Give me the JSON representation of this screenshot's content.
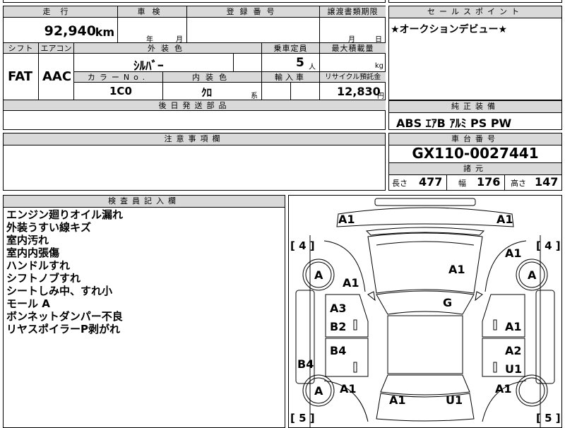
{
  "top_partial": {
    "text": "車 検 月"
  },
  "main": {
    "mileage_label": "走行",
    "mileage_value": "92,940",
    "mileage_unit": "km",
    "inspection_label": "車検",
    "inspection_year_unit": "年",
    "inspection_month_unit": "月",
    "registration_label": "登録番号",
    "transfer_label": "譲渡書類期限",
    "transfer_month_unit": "月",
    "transfer_day_unit": "日",
    "shift_label": "シフト",
    "aircon_label": "エアコン",
    "exterior_color_label": "外装色",
    "capacity_label": "乗車定員",
    "max_load_label": "最大積載量",
    "shift_value": "FAT",
    "aircon_value": "AAC",
    "exterior_color_value": "ｼﾙﾊﾞｰ",
    "capacity_value": "5",
    "capacity_unit": "人",
    "max_load_unit": "kg",
    "color_no_label": "カラーNo.",
    "interior_color_label": "内装色",
    "import_label": "輸入車",
    "recycle_label": "リサイクル預託金",
    "color_no_value": "1C0",
    "interior_color_value": "ｸﾛ",
    "interior_color_suffix": "系",
    "recycle_value": "12,830",
    "recycle_unit": "円",
    "later_parts_label": "後日発送部品"
  },
  "sales_point": {
    "label": "セールスポイント",
    "text": "★オークションデビュー★"
  },
  "equipment": {
    "label": "純正装備",
    "text": "ABS ｴｱB ｱﾙﾐ PS PW"
  },
  "notes": {
    "label": "注意事項欄"
  },
  "chassis": {
    "label": "車台番号",
    "value": "GX110-0027441",
    "spec_label": "諸元",
    "length_label": "長さ",
    "length_value": "477",
    "width_label": "幅",
    "width_value": "176",
    "height_label": "高さ",
    "height_value": "147"
  },
  "inspector": {
    "label": "検査員記入欄",
    "lines": [
      "エンジン廻りオイル漏れ",
      "外装うすい線キズ",
      "室内汚れ",
      "室内内張傷",
      "ハンドルすれ",
      "シフトノブすれ",
      "シートしみ中、すれ小",
      "モール A",
      "ボンネットダンパー不良",
      "リヤスポイラーP剥がれ"
    ]
  },
  "diagram": {
    "tires": [
      {
        "id": "front-left",
        "value": "4"
      },
      {
        "id": "front-right",
        "value": "4"
      },
      {
        "id": "rear-left",
        "value": "5"
      },
      {
        "id": "rear-right",
        "value": "5"
      }
    ],
    "wheel_marks": [
      "A",
      "A",
      "A"
    ],
    "marks": [
      {
        "id": "front-bumper-left",
        "text": "A1"
      },
      {
        "id": "front-bumper-right",
        "text": "A1"
      },
      {
        "id": "front-fender-right",
        "text": "A1"
      },
      {
        "id": "front-fender-left",
        "text": "A1"
      },
      {
        "id": "hood",
        "text": "A1"
      },
      {
        "id": "windshield",
        "text": "G"
      },
      {
        "id": "front-door-left-1",
        "text": "A3"
      },
      {
        "id": "front-door-left-2",
        "text": "B2"
      },
      {
        "id": "front-door-right",
        "text": "A1"
      },
      {
        "id": "rear-door-left",
        "text": "B4"
      },
      {
        "id": "rear-door-right-1",
        "text": "A2"
      },
      {
        "id": "rear-door-right-2",
        "text": "U1"
      },
      {
        "id": "side-sill-left",
        "text": "B4"
      },
      {
        "id": "rear-fender-left",
        "text": "A1"
      },
      {
        "id": "rear-fender-right",
        "text": "A1"
      },
      {
        "id": "trunk-left",
        "text": "A1"
      },
      {
        "id": "trunk-right",
        "text": "U1"
      }
    ]
  }
}
